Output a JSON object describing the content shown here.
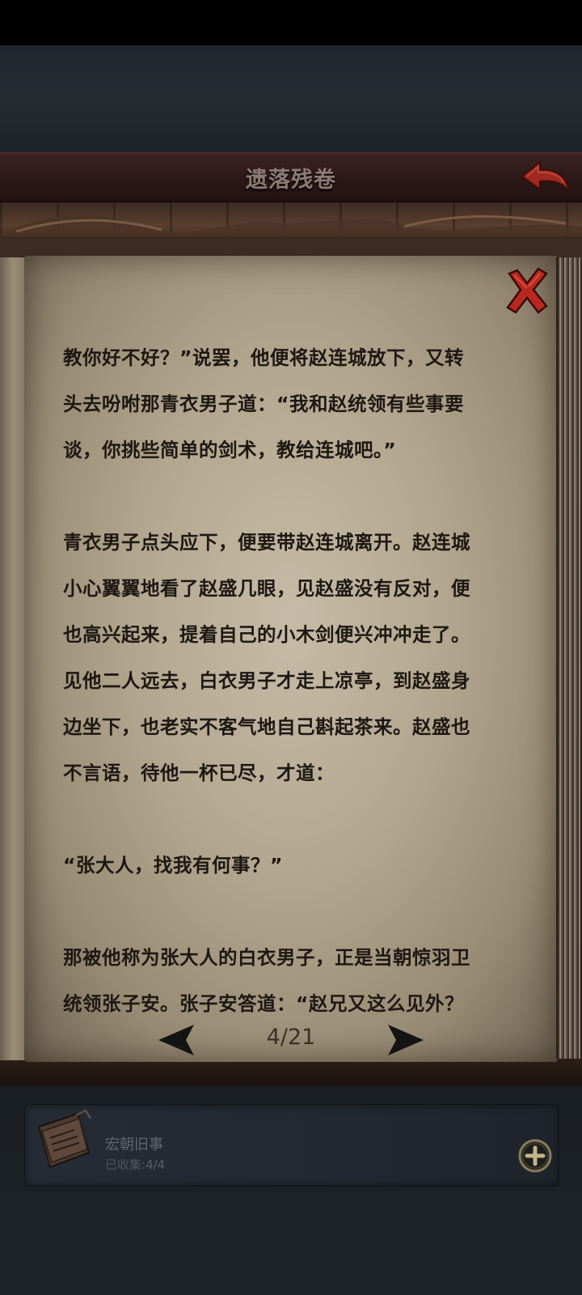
{
  "header": {
    "title": "遗落残卷"
  },
  "content": {
    "lines": [
      "教你好不好？”说罢，他便将赵连城放下，又转",
      "头去吩咐那青衣男子道：“我和赵统领有些事要",
      "谈，你挑些简单的剑术，教给连城吧。”",
      "",
      "青衣男子点头应下，便要带赵连城离开。赵连城",
      "小心翼翼地看了赵盛几眼，见赵盛没有反对，便",
      "也高兴起来，提着自己的小木剑便兴冲冲走了。",
      "见他二人远去，白衣男子才走上凉亭，到赵盛身",
      "边坐下，也老实不客气地自己斟起茶来。赵盛也",
      "不言语，待他一杯已尽，才道：",
      "",
      "“张大人，找我有何事？”",
      "",
      "那被他称为张大人的白衣男子，正是当朝惊羽卫",
      "统领张子安。张子安答道：“赵兄又这么见外？"
    ]
  },
  "pager": {
    "page": "4/21"
  },
  "collection": {
    "name": "宏朝旧事",
    "progress_label": "已收集:",
    "progress_value": "4/4"
  },
  "icons": {
    "back": "back-arrow-icon",
    "close": "close-x-icon",
    "prev": "left-triangle-icon",
    "next": "right-triangle-icon",
    "book": "book-icon",
    "plus": "plus-icon"
  },
  "colors": {
    "title_bar": "#2b1718",
    "accent_red": "#b8281f",
    "page": "#b3a78f",
    "text": "#1e1814"
  }
}
